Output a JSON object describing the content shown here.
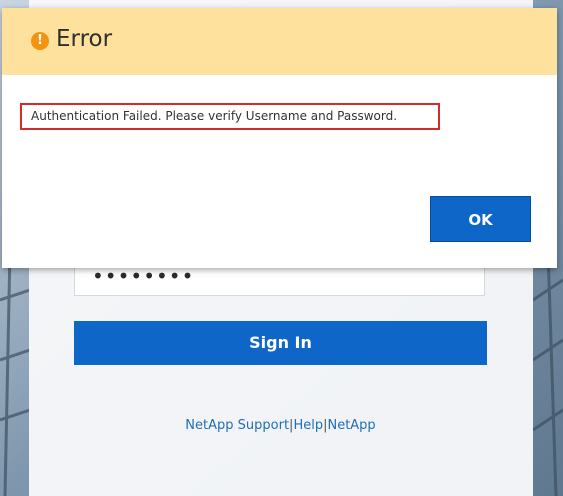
{
  "dialog": {
    "title": "Error",
    "icon": "warning-icon",
    "message": "Authentication Failed. Please verify Username and Password.",
    "ok_label": "OK",
    "header_color": "#fde19d",
    "highlight_color": "#d72b2b"
  },
  "login": {
    "password_value": "••••••••",
    "signin_label": "Sign In",
    "accent_color": "#0e66c8"
  },
  "footer": {
    "links": [
      "NetApp Support",
      "Help",
      "NetApp"
    ],
    "separator": "|"
  }
}
